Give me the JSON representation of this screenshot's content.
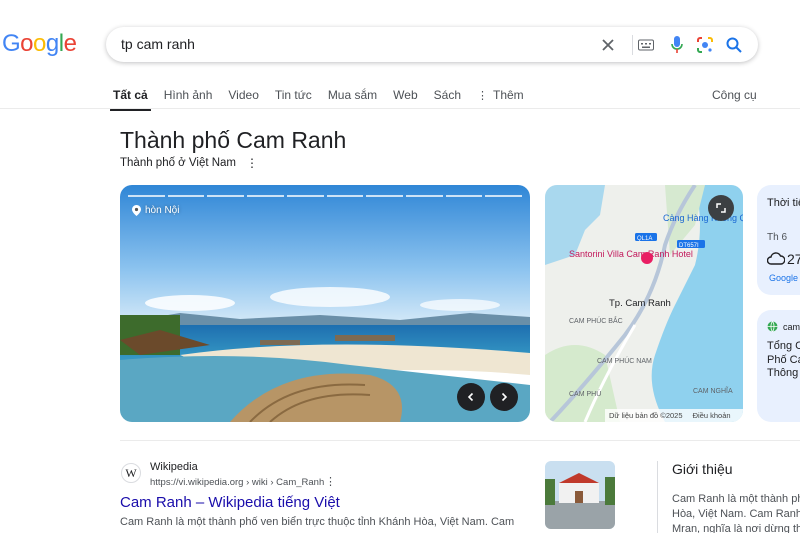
{
  "search": {
    "query": "tp cam ranh"
  },
  "tabs": [
    {
      "label": "Tất cả"
    },
    {
      "label": "Hình ảnh"
    },
    {
      "label": "Video"
    },
    {
      "label": "Tin tức"
    },
    {
      "label": "Mua sắm"
    },
    {
      "label": "Web"
    },
    {
      "label": "Sách"
    },
    {
      "label": "Thêm"
    }
  ],
  "tools_label": "Công cụ",
  "panel": {
    "title": "Thành phố Cam Ranh",
    "subtitle": "Thành phố ở Việt Nam",
    "photo_location": "hòn Nội",
    "map": {
      "labels": [
        "Cảng Hàng Không Quốc Tế Cam Ranh",
        "QL1A",
        "DT657I",
        "Santorini Villa Cam Ranh Hotel",
        "Tp. Cam Ranh",
        "CAM PHÚC BẮC",
        "CAM PHÚC NAM",
        "CAM PHÚ",
        "CAM NGHĨA"
      ],
      "footer": "Dữ liệu bản đồ ©2025",
      "footer_terms": "Điều khoản"
    }
  },
  "weather": {
    "label": "Thời tiết",
    "day": "Th 6",
    "temp": "27",
    "source": "Google"
  },
  "news": {
    "source": "cam",
    "text": "Tổng Cục Phố Ca Thông"
  },
  "result": {
    "site_name": "Wikipedia",
    "url": "https://vi.wikipedia.org › wiki › Cam_Ranh",
    "title": "Cam Ranh – Wikipedia tiếng Việt",
    "snippet": "Cam Ranh là một thành phố ven biển trực thuộc tỉnh Khánh Hòa, Việt Nam. Cam"
  },
  "about": {
    "title": "Giới thiệu",
    "text": "Cam Ranh là một thành phố Hòa, Việt Nam. Cam Ranh Mran, nghĩa là nơi dừng thu"
  },
  "colors": {
    "link": "#1a0dab",
    "accent": "#1a73e8"
  }
}
